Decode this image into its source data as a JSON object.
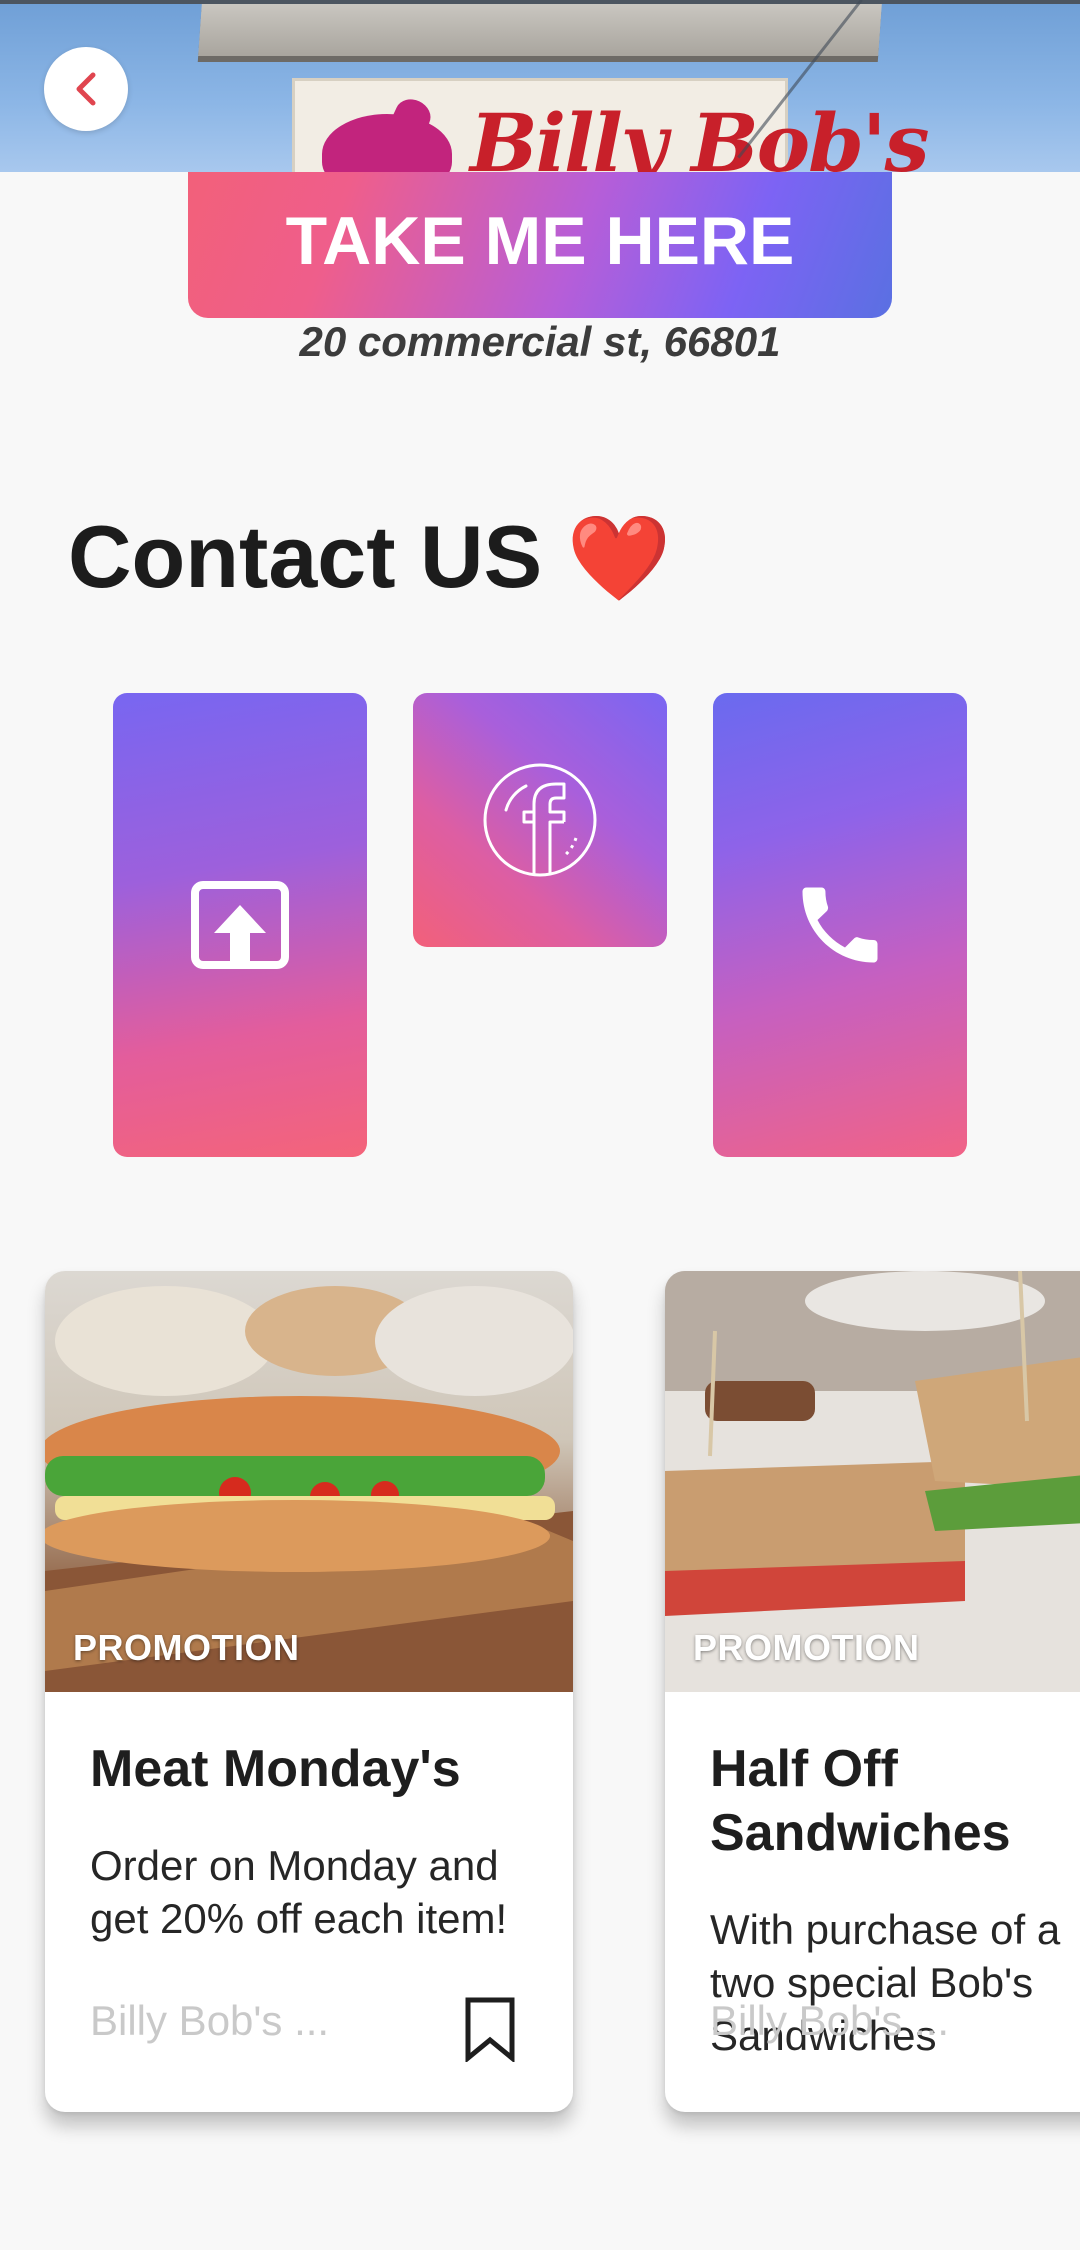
{
  "header": {
    "sign_text": "Billy Bob's",
    "back_icon": "chevron-left-icon"
  },
  "directions": {
    "button_label": "TAKE ME HERE",
    "address": "20 commercial st, 66801"
  },
  "contact": {
    "title": "Contact US",
    "title_emoji": "❤️",
    "tiles": [
      {
        "icon": "share-icon"
      },
      {
        "icon": "facebook-icon"
      },
      {
        "icon": "phone-icon"
      }
    ],
    "gradient_colors": [
      "#f2607a",
      "#b65ed8",
      "#7a66f2"
    ]
  },
  "promotions": [
    {
      "tag": "PROMOTION",
      "title": "Meat Monday's",
      "description": "Order on Monday and get 20% off each item!",
      "place": "Billy Bob's ..."
    },
    {
      "tag": "PROMOTION",
      "title": "Half Off Sandwiches",
      "description": "With purchase of a two special Bob's Sandwiches",
      "place": "Billy Bob's ..."
    }
  ]
}
